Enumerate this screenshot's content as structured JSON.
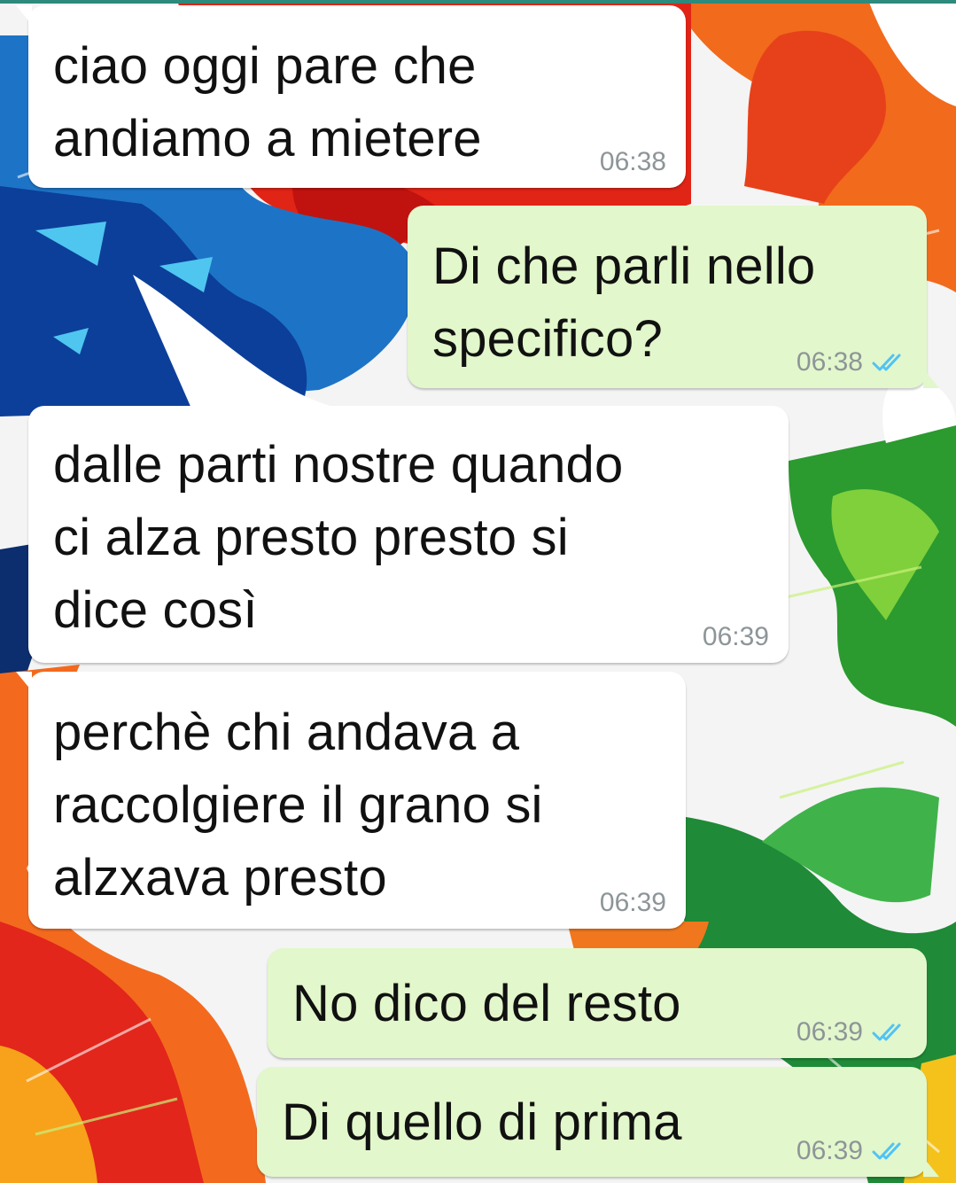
{
  "colors": {
    "incoming_bubble": "#ffffff",
    "outgoing_bubble": "#e2f7cb",
    "timestamp": "#8d9598",
    "read_tick": "#4fc3f7"
  },
  "messages": [
    {
      "direction": "incoming",
      "text": "ciao oggi pare che\nandiamo a mietere",
      "time": "06:38"
    },
    {
      "direction": "outgoing",
      "text": "Di che parli nello\nspecifico?",
      "time": "06:38",
      "status_icon": "double-check-icon"
    },
    {
      "direction": "incoming",
      "text": "dalle parti nostre quando\nci alza presto presto si\ndice così",
      "time": "06:39"
    },
    {
      "direction": "incoming",
      "text": "perchè chi andava a\nraccolgiere il grano si\nalzxava presto",
      "time": "06:39"
    },
    {
      "direction": "outgoing",
      "text": "No dico del resto",
      "time": "06:39",
      "status_icon": "double-check-icon"
    },
    {
      "direction": "outgoing",
      "text": "Di quello di prima",
      "time": "06:39",
      "status_icon": "double-check-icon"
    }
  ]
}
